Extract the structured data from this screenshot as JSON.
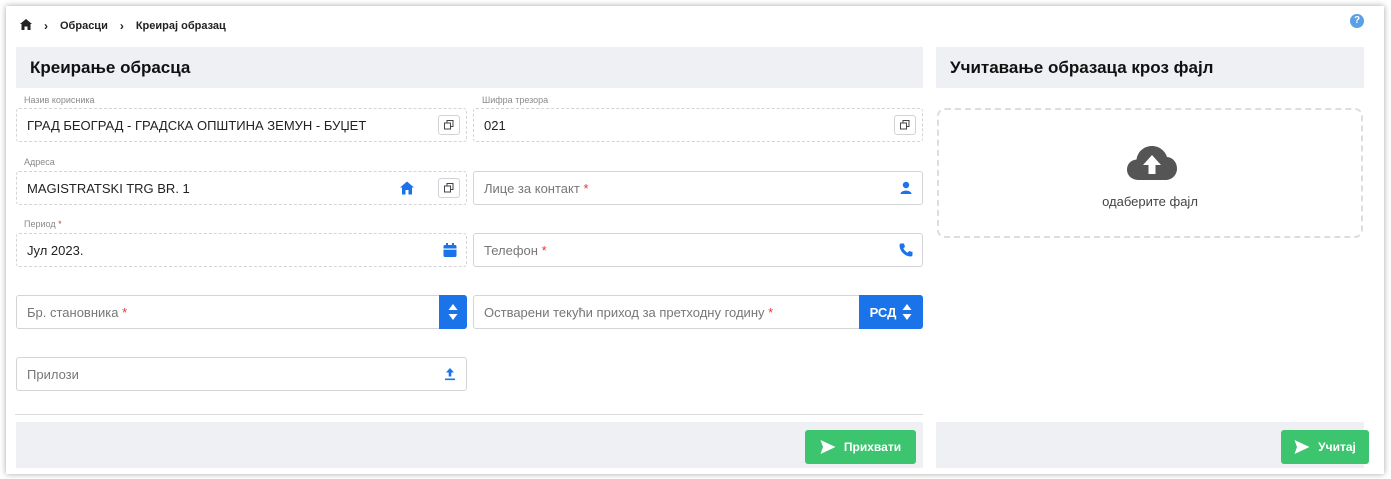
{
  "breadcrumb": {
    "item1": "Обрасци",
    "item2": "Креирај образац"
  },
  "left_panel": {
    "title": "Креирање обрасца"
  },
  "right_panel": {
    "title": "Учитавање образаца кроз фајл",
    "upload_text": "одаберите фајл",
    "load_button": "Учитај"
  },
  "form": {
    "user_name_label": "Назив корисника",
    "user_name_value": "ГРАД БЕОГРАД - ГРАДСКА ОПШТИНА ЗЕМУН - БУЏЕТ",
    "treasury_label": "Шифра трезора",
    "treasury_value": "021",
    "address_label": "Адреса",
    "address_value": "MAGISTRATSKI TRG BR. 1",
    "contact_placeholder": "Лице за контакт",
    "period_label": "Период",
    "period_value": "Јул 2023.",
    "phone_placeholder": "Телефон",
    "population_placeholder": "Бр. становника",
    "income_placeholder": "Остварени текући приход за претходну годину",
    "currency": "РСД",
    "attachments_placeholder": "Прилози",
    "required_mark": "*"
  },
  "accept_button": "Прихвати",
  "help_icon": "?",
  "colors": {
    "accent_blue": "#1a73e8",
    "green": "#3cc46e",
    "required": "#e53935"
  }
}
